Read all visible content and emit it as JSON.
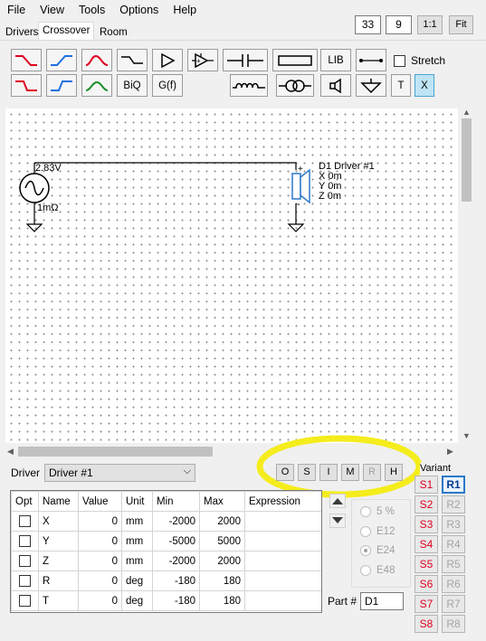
{
  "menu": [
    "File",
    "View",
    "Tools",
    "Options",
    "Help"
  ],
  "header": {
    "box1": "33",
    "box2": "9",
    "btn_ratio": "1:1",
    "btn_fit": "Fit"
  },
  "tabs": [
    "Drivers",
    "Crossover",
    "Room"
  ],
  "toolbar": {
    "lib": "LIB",
    "biq": "BiQ",
    "gf": "G(f)",
    "t": "T",
    "x": "X",
    "stretch_label": "Stretch"
  },
  "icons": {
    "filter_highpass": "highpass-filter-icon",
    "filter_lowpass": "lowpass-filter-icon",
    "amplifier": "amplifier-icon",
    "capacitor": "capacitor-icon",
    "resistor": "resistor-icon",
    "inductor": "inductor-icon",
    "transformer": "transformer-icon",
    "speaker": "speaker-icon",
    "ground": "ground-icon",
    "wire": "wire-icon"
  },
  "schematic": {
    "source_voltage": "2.83V",
    "source_impedance": "1mΩ",
    "driver_label": "D1 Driver #1",
    "driver_x": "X 0m",
    "driver_y": "Y 0m",
    "driver_z": "Z 0m",
    "plus": "+",
    "minus": "-"
  },
  "optimize_buttons": [
    "O",
    "S",
    "I",
    "M",
    "R",
    "H"
  ],
  "driver_select": {
    "label": "Driver",
    "value": "Driver #1"
  },
  "table": {
    "headers": [
      "Opt",
      "Name",
      "Value",
      "Unit",
      "Min",
      "Max",
      "Expression"
    ],
    "rows": [
      {
        "name": "X",
        "value": "0",
        "unit": "mm",
        "min": "-2000",
        "max": "2000",
        "expr": ""
      },
      {
        "name": "Y",
        "value": "0",
        "unit": "mm",
        "min": "-5000",
        "max": "5000",
        "expr": ""
      },
      {
        "name": "Z",
        "value": "0",
        "unit": "mm",
        "min": "-2000",
        "max": "2000",
        "expr": ""
      },
      {
        "name": "R",
        "value": "0",
        "unit": "deg",
        "min": "-180",
        "max": "180",
        "expr": ""
      },
      {
        "name": "T",
        "value": "0",
        "unit": "deg",
        "min": "-180",
        "max": "180",
        "expr": ""
      }
    ]
  },
  "tolerance": {
    "options": [
      "5 %",
      "E12",
      "E24",
      "E48"
    ],
    "selected": "E24"
  },
  "part": {
    "label": "Part #",
    "value": "D1"
  },
  "variant": {
    "label": "Variant",
    "s_buttons": [
      "S1",
      "S2",
      "S3",
      "S4",
      "S5",
      "S6",
      "S7",
      "S8"
    ],
    "r_buttons": [
      "R1",
      "R2",
      "R3",
      "R4",
      "R5",
      "R6",
      "R7",
      "R8"
    ],
    "active": "R1"
  },
  "colors": {
    "highlight": "#f5ec1c",
    "red_curve": "#e0001e",
    "blue_curve": "#1e6fe0",
    "green_curve": "#1a8f2a",
    "speaker_blue": "#2b78c8"
  }
}
